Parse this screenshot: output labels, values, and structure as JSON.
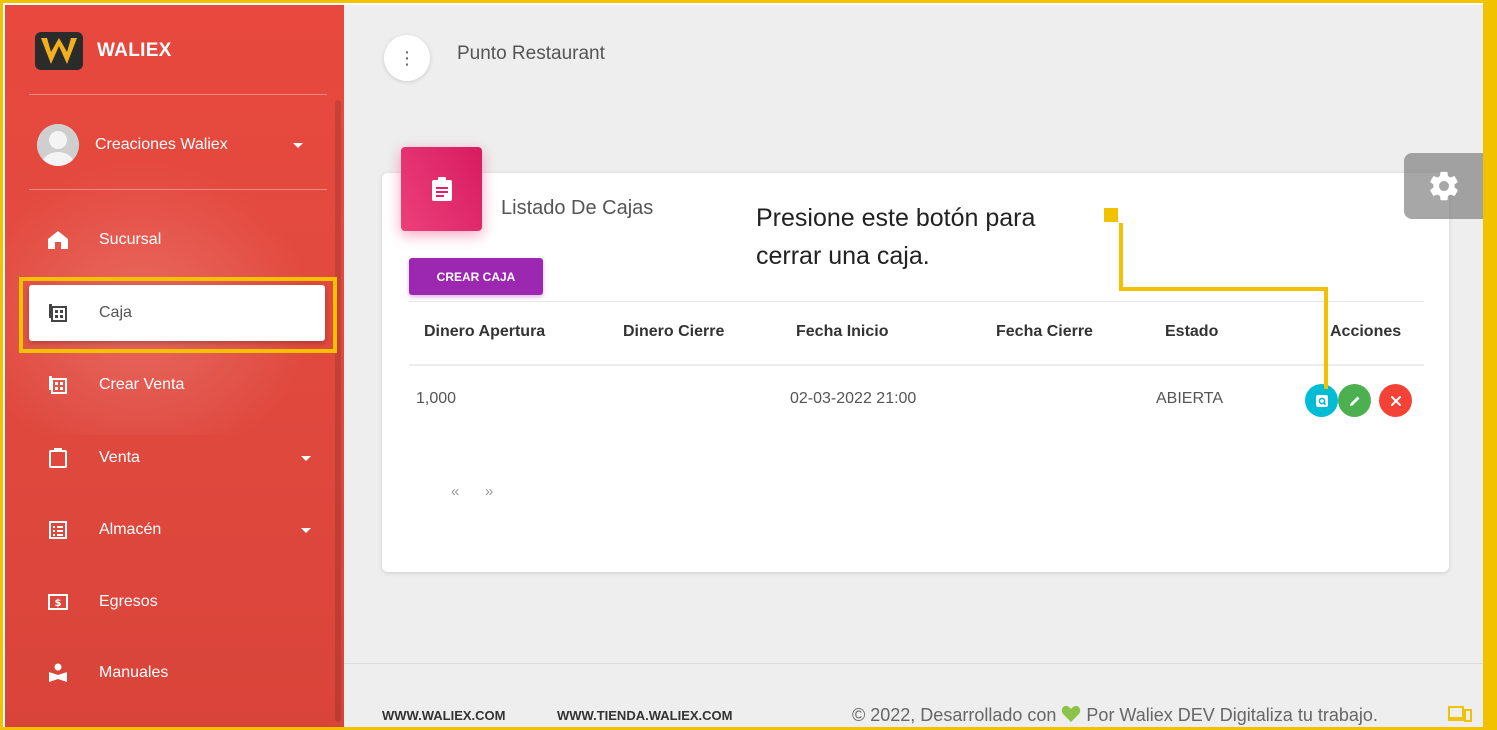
{
  "brand": {
    "name": "WALIEX"
  },
  "user": {
    "name": "Creaciones Waliex"
  },
  "sidebar": {
    "items": [
      {
        "label": "Sucursal"
      },
      {
        "label": "Caja"
      },
      {
        "label": "Crear Venta"
      },
      {
        "label": "Venta"
      },
      {
        "label": "Almacén"
      },
      {
        "label": "Egresos"
      },
      {
        "label": "Manuales"
      }
    ]
  },
  "header": {
    "title": "Punto Restaurant"
  },
  "card": {
    "title": "Listado De Cajas",
    "create_label": "CREAR CAJA",
    "columns": [
      "Dinero Apertura",
      "Dinero Cierre",
      "Fecha Inicio",
      "Fecha Cierre",
      "Estado",
      "Acciones"
    ],
    "rows": [
      {
        "apertura": "1,000",
        "cierre": "",
        "inicio": "02-03-2022 21:00",
        "fin": "",
        "estado": "ABIERTA"
      }
    ],
    "pager": {
      "prev": "«",
      "next": "»"
    }
  },
  "annotation": {
    "line1": "Presione este botón para",
    "line2": "cerrar una caja."
  },
  "footer": {
    "link1": "WWW.WALIEX.COM",
    "link2": "WWW.TIENDA.WALIEX.COM",
    "copy_before": "© 2022, Desarrollado con",
    "copy_after": "Por Waliex DEV Digitaliza tu trabajo."
  },
  "colors": {
    "sidebar": "#e24a3f",
    "accent_purple": "#9c27b0",
    "icon_pink": "#e91e63",
    "highlight": "#f2c200",
    "view_btn": "#00bcd4",
    "edit_btn": "#4caf50",
    "close_btn": "#f44336"
  }
}
